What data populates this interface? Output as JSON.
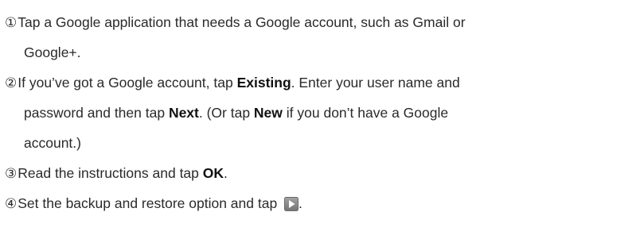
{
  "steps": [
    {
      "number": "①",
      "line1": "Tap a Google application that needs a Google account, such as Gmail or",
      "line2": "Google+."
    },
    {
      "number": "②",
      "l1_pre": "If you’ve got a Google account, tap ",
      "l1_bold": "Existing",
      "l1_post": ". Enter your user name and",
      "l2_pre": "password and then tap ",
      "l2_bold1": "Next",
      "l2_mid": ". (Or tap ",
      "l2_bold2": "New",
      "l2_post": " if you don’t have a Google",
      "line3": "account.)"
    },
    {
      "number": "③",
      "pre": "Read the instructions and tap ",
      "bold": "OK",
      "post": "."
    },
    {
      "number": "④",
      "pre": "Set the backup and restore option and tap ",
      "icon": "play-next-icon",
      "post": "."
    }
  ],
  "colors": {
    "text": "#2a2a2a",
    "icon_bg": "#8a8a8a",
    "icon_fg": "#ffffff"
  }
}
